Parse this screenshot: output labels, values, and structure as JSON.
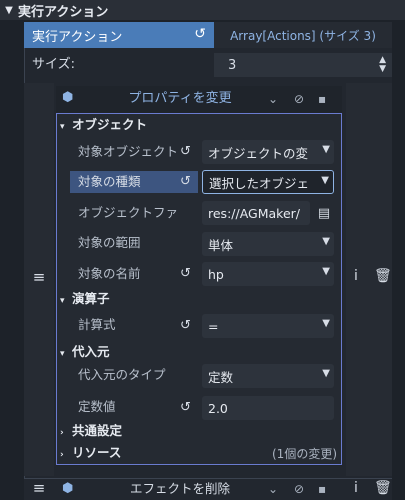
{
  "section": {
    "title": "実行アクション",
    "chevron_icon": "chevron-down-icon"
  },
  "tabs": {
    "active_label": "実行アクション",
    "inactive_label": "Array[Actions] (サイズ 3)"
  },
  "size": {
    "label": "サイズ:",
    "value": "3"
  },
  "item1": {
    "title": "プロパティを変更",
    "icon": "cube-icon",
    "categories": {
      "object": "オブジェクト",
      "operator": "演算子",
      "source": "代入元",
      "common": "共通設定",
      "resources": "リソース"
    },
    "props": {
      "target_object": {
        "label": "対象オブジェクト",
        "value": "オブジェクトの変"
      },
      "target_kind": {
        "label": "対象の種類",
        "value": "選択したオブジェ"
      },
      "object_file": {
        "label": "オブジェクトファ",
        "value": "res://AGMaker/"
      },
      "target_range": {
        "label": "対象の範囲",
        "value": "単体"
      },
      "target_name": {
        "label": "対象の名前",
        "value": "hp"
      },
      "formula": {
        "label": "計算式",
        "value": "="
      },
      "source_type": {
        "label": "代入元のタイプ",
        "value": "定数"
      },
      "constant": {
        "label": "定数値",
        "value": "2.0"
      }
    },
    "resource_changes": "(1個の変更)"
  },
  "item2": {
    "title": "エフェクトを削除"
  },
  "colors": {
    "accent": "#4a7cb8",
    "link": "#8fb4e4",
    "background": "#1d2229",
    "inspector_border": "#6a7bd0"
  }
}
